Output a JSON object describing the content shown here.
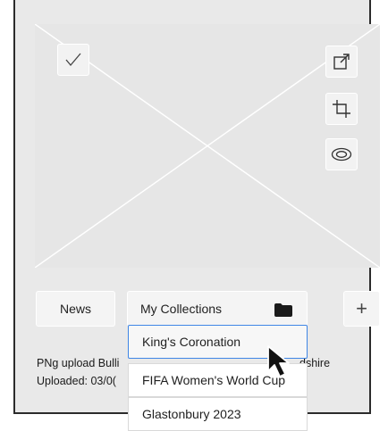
{
  "toolbar": {
    "news_label": "News",
    "collections_label": "My Collections",
    "add_symbol": "+"
  },
  "dropdown": {
    "items": [
      "King's Coronation",
      "FIFA Women's World Cup",
      "Glastonbury 2023"
    ],
    "selected": "King's Coronation"
  },
  "meta": {
    "line1_left": "PNg upload Bulli",
    "line1_right": "dshire",
    "line2": "Uploaded: 03/0("
  },
  "icons": {
    "select": "checkmark-icon",
    "open": "external-link-icon",
    "crop": "crop-icon",
    "view": "eye-icon",
    "folder": "folder-icon",
    "add": "plus-icon",
    "cursor": "mouse-pointer-icon"
  },
  "colors": {
    "card_bg": "#e9e9e9",
    "accent": "#3f86e6"
  }
}
